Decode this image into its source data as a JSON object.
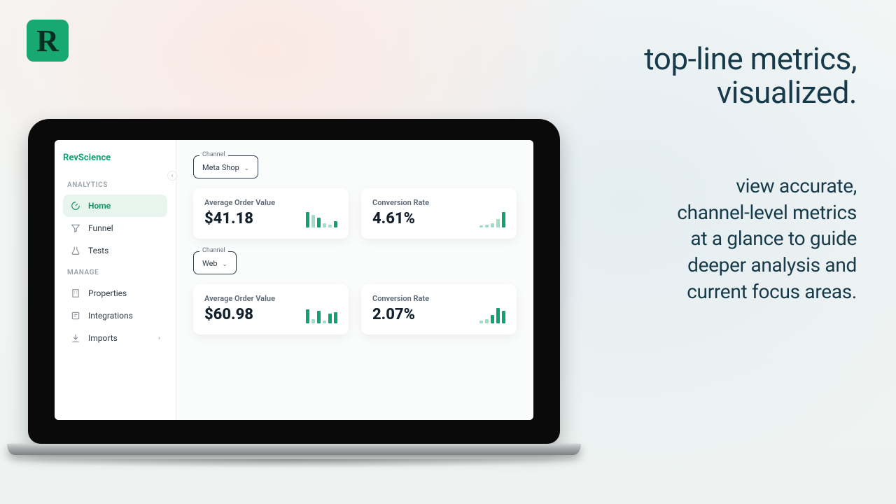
{
  "logo_letter": "R",
  "hero": {
    "headline_l1": "top-line metrics,",
    "headline_l2": "visualized.",
    "sub_l1": "view accurate,",
    "sub_l2": "channel-level metrics",
    "sub_l3": "at a glance to guide",
    "sub_l4": "deeper analysis and",
    "sub_l5": "current focus areas."
  },
  "app": {
    "brand": "RevScience",
    "sections": {
      "analytics_label": "ANALYTICS",
      "manage_label": "MANAGE"
    },
    "nav": {
      "home": "Home",
      "funnel": "Funnel",
      "tests": "Tests",
      "properties": "Properties",
      "integrations": "Integrations",
      "imports": "Imports"
    },
    "channel_label": "Channel",
    "groups": [
      {
        "channel": "Meta Shop",
        "cards": {
          "aov_label": "Average Order Value",
          "aov_value": "$41.18",
          "cvr_label": "Conversion Rate",
          "cvr_value": "4.61%"
        }
      },
      {
        "channel": "Web",
        "cards": {
          "aov_label": "Average Order Value",
          "aov_value": "$60.98",
          "cvr_label": "Conversion Rate",
          "cvr_value": "2.07%"
        }
      }
    ]
  },
  "chart_data": [
    {
      "type": "bar",
      "title": "Average Order Value — Meta Shop",
      "values": [
        22,
        18,
        14,
        6,
        4,
        9
      ]
    },
    {
      "type": "bar",
      "title": "Conversion Rate — Meta Shop",
      "values": [
        3,
        4,
        6,
        12,
        22
      ]
    },
    {
      "type": "bar",
      "title": "Average Order Value — Web",
      "values": [
        20,
        6,
        18,
        4,
        14,
        16
      ]
    },
    {
      "type": "bar",
      "title": "Conversion Rate — Web",
      "values": [
        4,
        6,
        12,
        22,
        18
      ]
    }
  ]
}
